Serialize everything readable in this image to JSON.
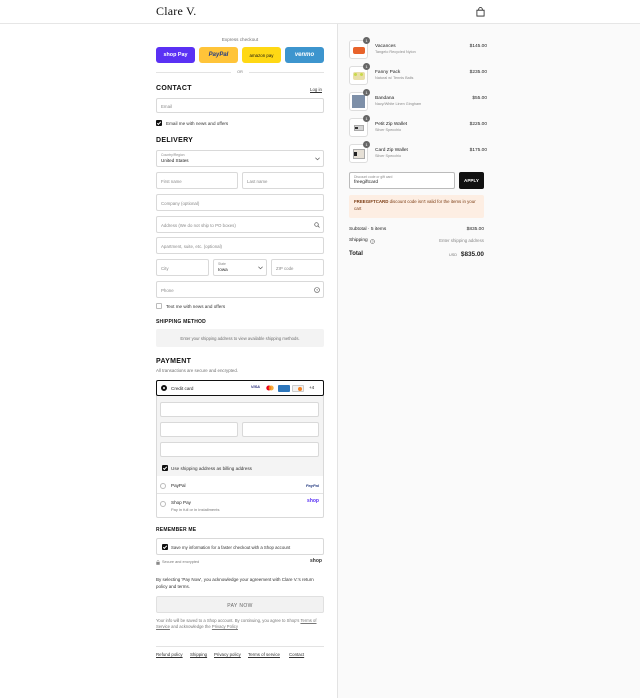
{
  "header": {
    "logo": "Clare V."
  },
  "express": {
    "label": "Express checkout",
    "buttons": [
      {
        "label": "shop Pay",
        "bg": "#5a31f4",
        "fg": "#ffffff"
      },
      {
        "label": "PayPal",
        "bg": "#ffc439",
        "fg": "#253b80"
      },
      {
        "label": "amazon pay",
        "bg": "#ffd814",
        "fg": "#111111"
      },
      {
        "label": "venmo",
        "bg": "#3d95ce",
        "fg": "#ffffff"
      }
    ],
    "or": "OR"
  },
  "contact": {
    "title": "CONTACT",
    "login": "Log in",
    "email_placeholder": "Email",
    "email_news": "Email me with news and offers"
  },
  "delivery": {
    "title": "DELIVERY",
    "country_label": "Country/Region",
    "country_value": "United States",
    "first_name": "First name",
    "last_name": "Last name",
    "company": "Company (optional)",
    "address": "Address (We do not ship to PO boxes)",
    "apartment": "Apartment, suite, etc. (optional)",
    "city": "City",
    "state_label": "State",
    "state_value": "Iowa",
    "zip": "ZIP code",
    "phone": "Phone",
    "text_news": "Text me with news and offers"
  },
  "shipping": {
    "title": "SHIPPING METHOD",
    "message": "Enter your shipping address to view available shipping methods."
  },
  "payment": {
    "title": "PAYMENT",
    "subtitle": "All transactions are secure and encrypted.",
    "credit_card": "Credit card",
    "card_more": "+4",
    "billing_same": "Use shipping address as billing address",
    "paypal": "PayPal",
    "paypal_logo": "PayPal",
    "shop_pay": "Shop Pay",
    "shop_pay_sub": "Pay in full or in installments",
    "shop_logo": "shop"
  },
  "remember": {
    "title": "REMEMBER ME",
    "save_info": "Save my information for a faster checkout with a Shop account",
    "secure": "Secure and encrypted",
    "shop_logo": "shop"
  },
  "terms_text": "By selecting 'Pay Now', you acknowledge your agreement with Clare V.'s return policy and terms.",
  "pay_now": "PAY NOW",
  "footer_note": {
    "prefix": "Your info will be saved to a Shop account. By continuing, you agree to Shop's",
    "terms": "Terms of Service",
    "middle": "and acknowledge the",
    "privacy": "Privacy Policy"
  },
  "footer_links": [
    "Refund policy",
    "Shipping",
    "Privacy policy",
    "Terms of service",
    "Contact"
  ],
  "cart": {
    "items": [
      {
        "qty": "1",
        "name": "Vacances",
        "desc": "Tangelo Recycled Nylon",
        "price": "$145.00",
        "color": "#e8632b"
      },
      {
        "qty": "1",
        "name": "Fanny Pack",
        "desc": "Natural w/ Tennis Balls",
        "price": "$235.00",
        "color": "#e9dfa8"
      },
      {
        "qty": "1",
        "name": "Bandana",
        "desc": "Navy/White Linen Gingham",
        "price": "$55.00",
        "color": "#7d8fa8"
      },
      {
        "qty": "1",
        "name": "Petit Zip Wallet",
        "desc": "Silver Specchio",
        "price": "$225.00",
        "color": "#d4d4d4"
      },
      {
        "qty": "1",
        "name": "Card Zip Wallet",
        "desc": "Silver Specchio",
        "price": "$175.00",
        "color": "#e6e0d6"
      }
    ],
    "discount_label": "Discount code or gift card",
    "discount_value": "freegiftcard",
    "apply": "APPLY",
    "warning_code": "FREEGIFTCARD",
    "warning_text": "discount code isn't valid for the items in your cart",
    "subtotal_label": "Subtotal · 5 items",
    "subtotal_value": "$835.00",
    "shipping_label": "Shipping",
    "shipping_value": "Enter shipping address",
    "total_label": "Total",
    "currency": "USD",
    "total_value": "$835.00"
  }
}
